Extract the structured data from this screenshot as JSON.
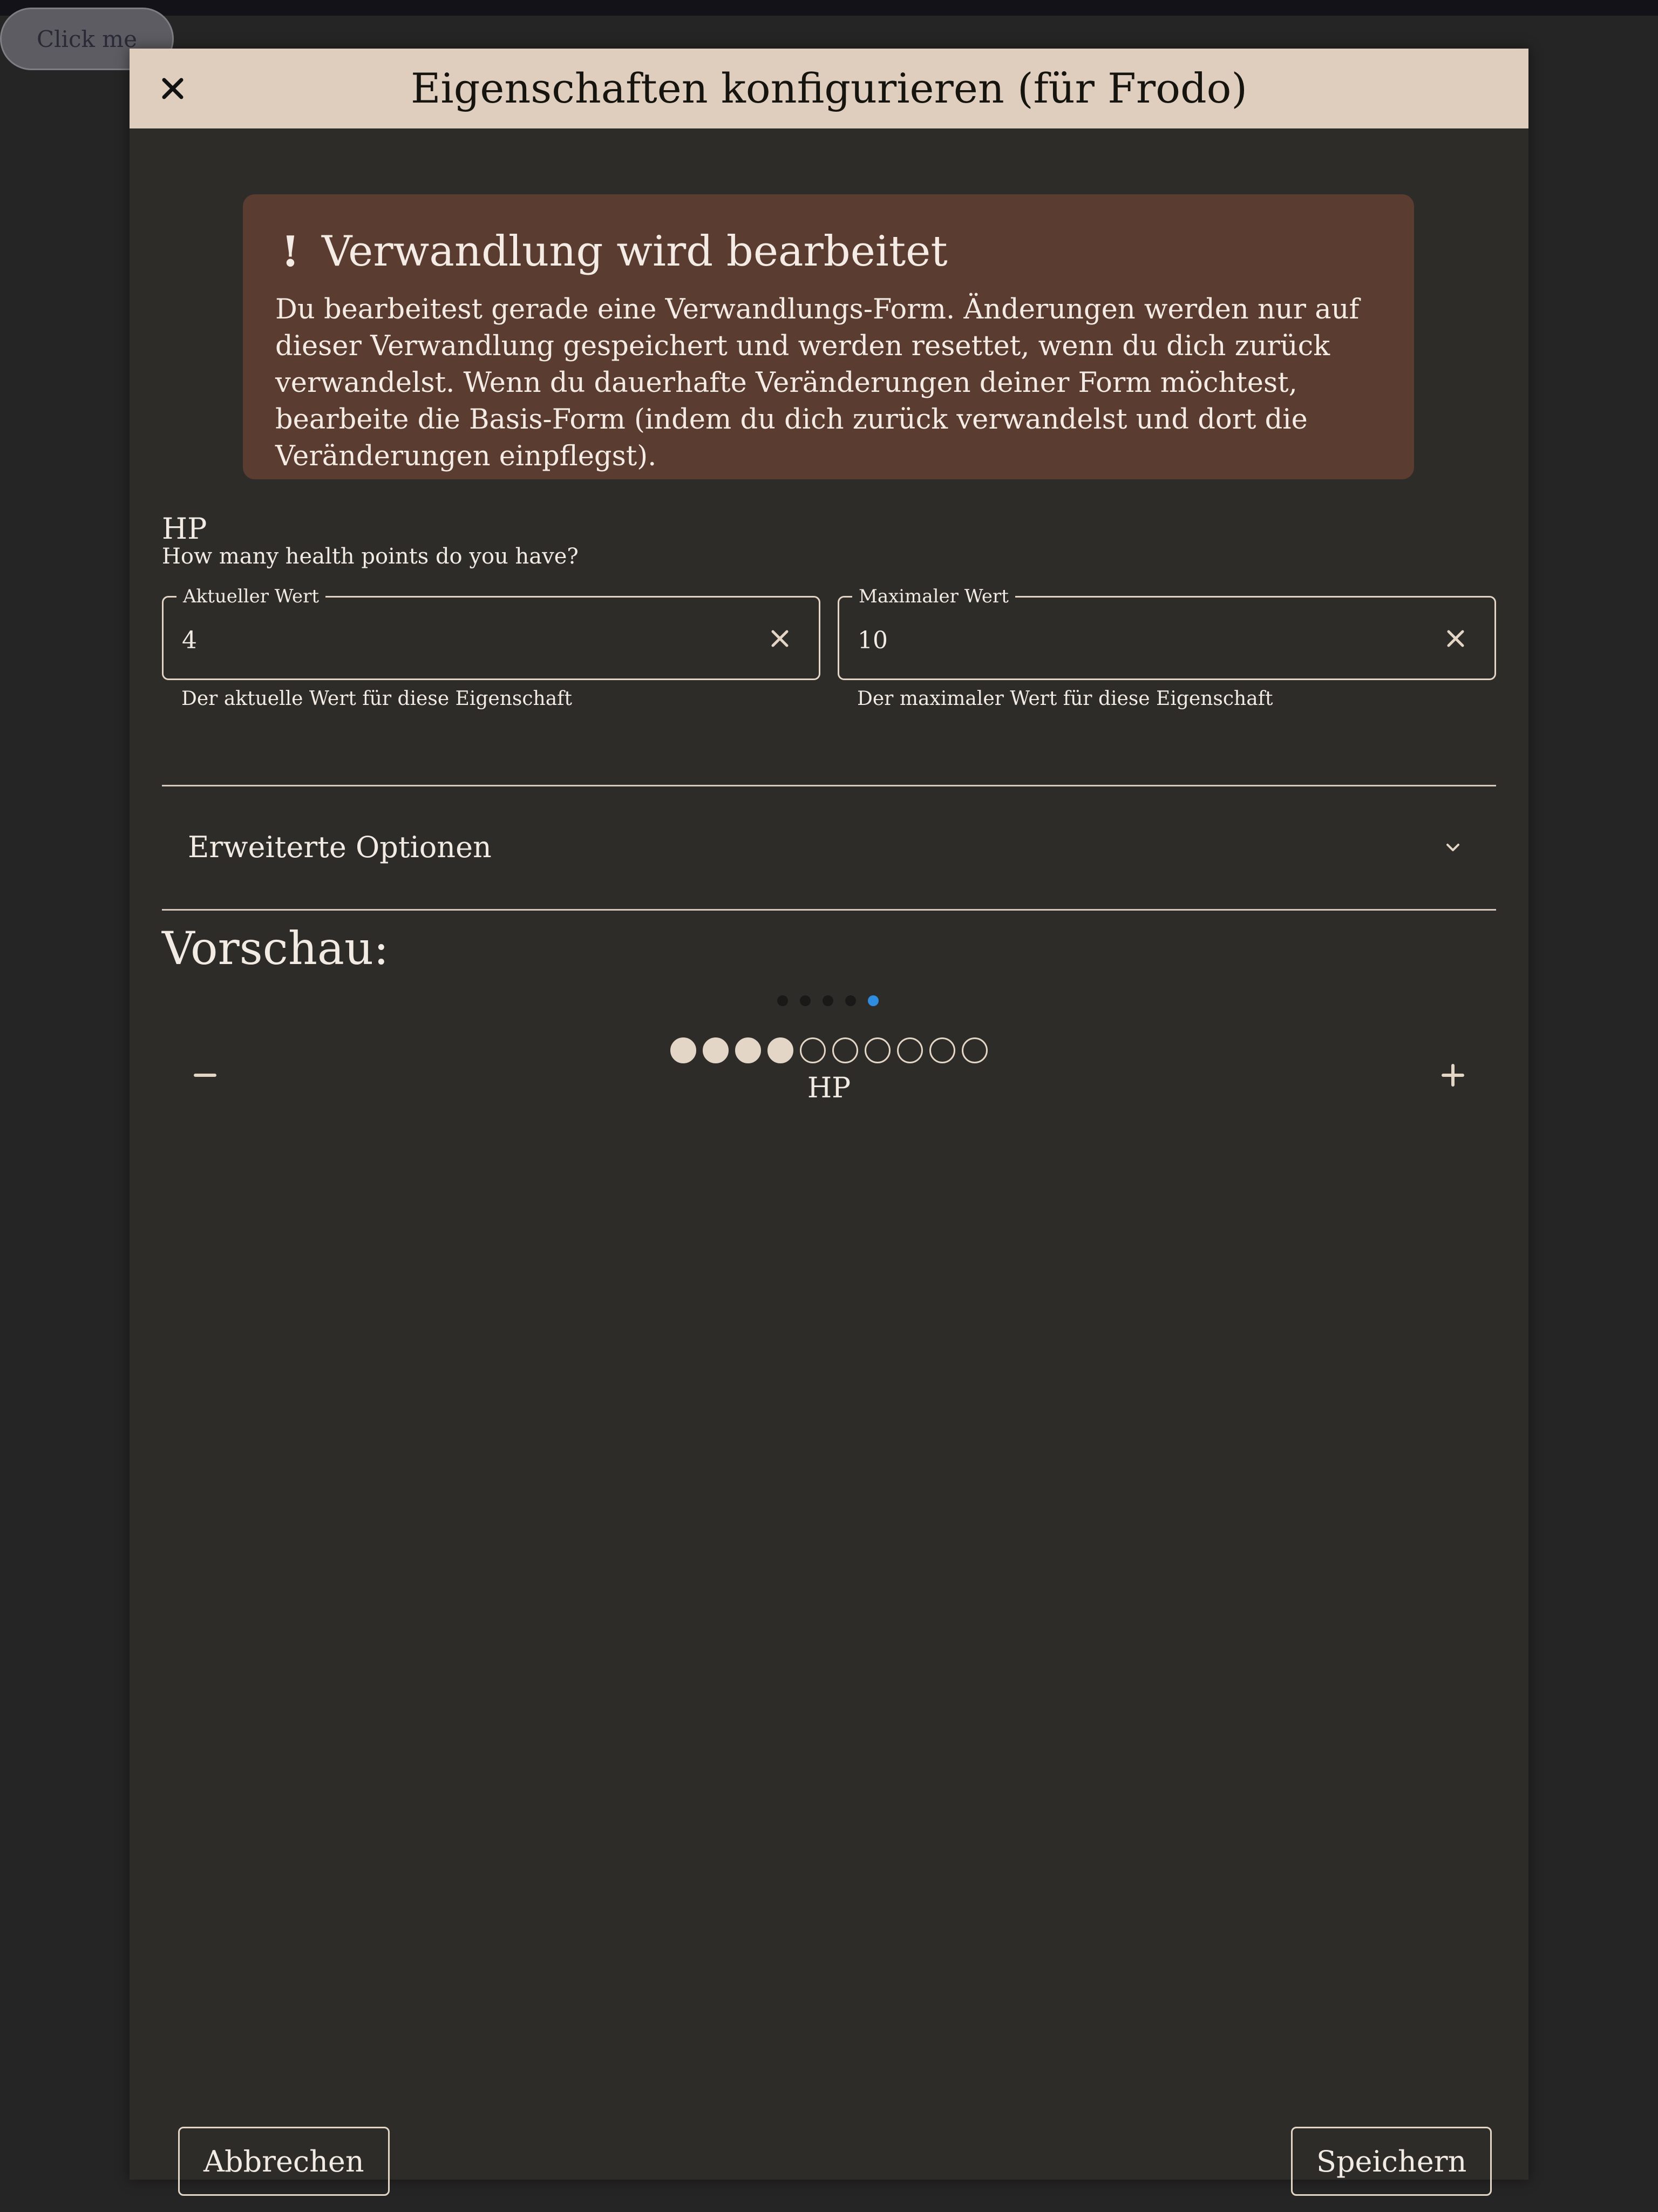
{
  "page": {
    "click_me_label": "Click me"
  },
  "dialog": {
    "title": "Eigenschaften konfigurieren (für Frodo)",
    "close_icon": "close-icon"
  },
  "banner": {
    "icon": "exclamation-icon",
    "icon_glyph": "!",
    "title": "Verwandlung wird bearbeitet",
    "text": "Du bearbeitest gerade eine Verwandlungs-Form. Änderungen werden nur auf dieser Verwandlung gespeichert und werden resettet, wenn du dich zurück verwandelst. Wenn du dauerhafte Veränderungen deiner Form möchtest, bearbeite die Basis-Form (indem du dich zurück verwandelst und dort die Veränderungen einpflegst)."
  },
  "attribute": {
    "name": "HP",
    "description": "How many health points do you have?",
    "current": {
      "label": "Aktueller Wert",
      "value": "4",
      "helper": "Der aktuelle Wert für diese Eigenschaft"
    },
    "max": {
      "label": "Maximaler Wert",
      "value": "10",
      "helper": "Der maximaler Wert für diese Eigenschaft"
    }
  },
  "advanced": {
    "label": "Erweiterte Optionen",
    "icon": "chevron-down-icon"
  },
  "preview": {
    "title": "Vorschau:",
    "carousel_count": 5,
    "carousel_active_index": 4,
    "current": 4,
    "max": 10,
    "label": "HP",
    "decrement_icon": "minus-icon",
    "increment_icon": "plus-icon"
  },
  "footer": {
    "cancel_label": "Abbrechen",
    "save_label": "Speichern"
  },
  "colors": {
    "header_bg": "#dfcebd",
    "dialog_bg": "#2d2c29",
    "banner_bg": "#5a3c31",
    "accent": "#e4d6c7",
    "active_dot": "#2f8ddf"
  }
}
